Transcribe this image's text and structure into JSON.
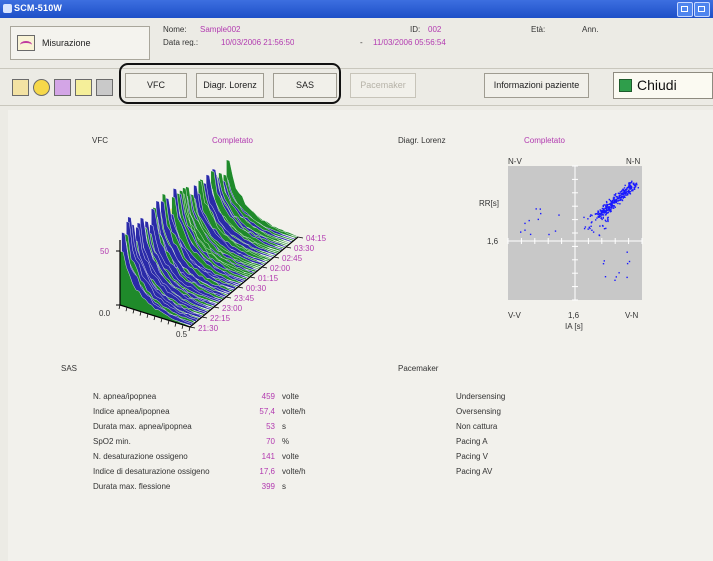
{
  "window": {
    "title": "SCM-510W"
  },
  "header": {
    "misurazione_label": "Misurazione",
    "nome_label": "Nome:",
    "nome_value": "Sample002",
    "data_reg_label": "Data reg.:",
    "data_reg_start": "10/03/2006 21:56:50",
    "data_reg_sep": "-",
    "data_reg_end": "11/03/2006 05:56:54",
    "id_label": "ID:",
    "id_value": "002",
    "eta_label": "Età:",
    "anni_label": "Ann."
  },
  "toolbar": {
    "buttons": [
      "VFC",
      "Diagr. Lorenz",
      "SAS",
      "Pacemaker",
      "Informazioni paziente"
    ],
    "chiudi_label": "Chiudi",
    "icons": [
      "report-icon",
      "alarm-icon",
      "waveform-icon",
      "edit-icon",
      "print-icon"
    ]
  },
  "vfc": {
    "title": "VFC",
    "status": "Completato",
    "y_ticks": [
      "50",
      "0.0"
    ],
    "x_tick": "0.5",
    "time_ticks": [
      "04:15",
      "03:30",
      "02:45",
      "02:00",
      "01:15",
      "00:30",
      "23:45",
      "23:00",
      "22:15",
      "21:30"
    ]
  },
  "lorenz": {
    "title": "Diagr. Lorenz",
    "status": "Completato",
    "nv_label": "N-V",
    "nn_label": "N-N",
    "vv_label": "V-V",
    "vn_label": "V-N",
    "y_axis_label": "RR[s]",
    "y_tick": "1,6",
    "x_tick": "1,6",
    "x_axis_label": "IA [s]"
  },
  "sas": {
    "title": "SAS",
    "rows": [
      {
        "label": "N. apnea/ipopnea",
        "value": "459",
        "unit": "volte"
      },
      {
        "label": "Indice apnea/ipopnea",
        "value": "57,4",
        "unit": "volte/h"
      },
      {
        "label": "Durata max. apnea/ipopnea",
        "value": "53",
        "unit": "s"
      },
      {
        "label": "SpO2 min.",
        "value": "70",
        "unit": "%"
      },
      {
        "label": "N. desaturazione ossigeno",
        "value": "141",
        "unit": "volte"
      },
      {
        "label": "Indice di desaturazione ossigeno",
        "value": "17,6",
        "unit": "volte/h"
      },
      {
        "label": "Durata max. flessione",
        "value": "399",
        "unit": "s"
      }
    ]
  },
  "pacemaker": {
    "title": "Pacemaker",
    "items": [
      "Undersensing",
      "Oversensing",
      "Non cattura",
      "Pacing A",
      "Pacing V",
      "Pacing AV"
    ]
  },
  "colors": {
    "accent": "#b23ab0",
    "titlebar": "#1d4fc7",
    "plot_green": "#1f8a2a",
    "plot_blue": "#2a2aa8",
    "plot_yellow": "#e8e23a",
    "lorenz_points": "#1a1aff",
    "lorenz_bg": "#c8c8c8"
  }
}
